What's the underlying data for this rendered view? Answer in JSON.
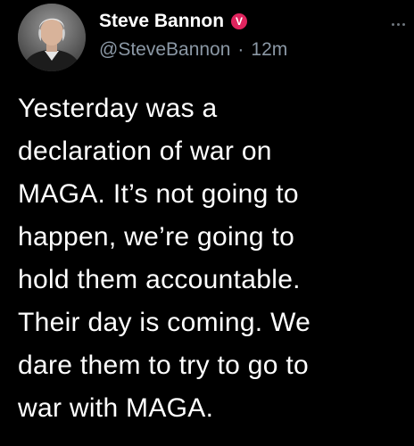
{
  "tweet": {
    "author": {
      "display_name": "Steve Bannon",
      "handle": "@SteveBannon",
      "verified_badge_letter": "V",
      "verified_badge_color": "#e0245e",
      "avatar_icon": "profile-photo"
    },
    "separator": "·",
    "timestamp": "12m",
    "more_icon": "more-dots-icon",
    "text": "Yesterday was a\ndeclaration of war on\nMAGA. It’s not going to\nhappen, we’re going to\nhold them accountable.\nTheir day is coming. We\ndare them to try to go to\nwar with MAGA."
  },
  "colors": {
    "background": "#000000",
    "primary_text": "#ffffff",
    "secondary_text": "#8b98a5"
  }
}
